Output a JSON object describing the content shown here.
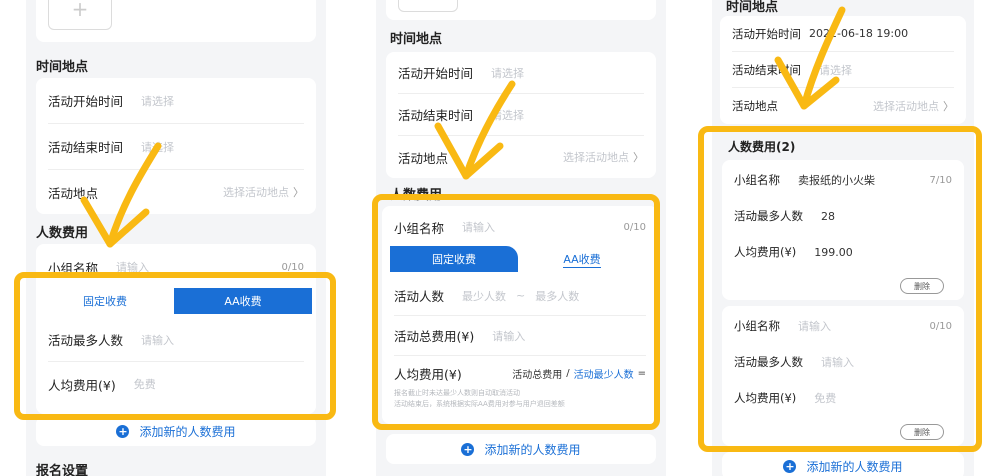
{
  "colors": {
    "accent": "#1a6fd6",
    "highlight": "#f9b913",
    "placeholder": "#c3c6cc"
  },
  "p1": {
    "section_time": "时间地点",
    "start_label": "活动开始时间",
    "start_ph": "请选择",
    "end_label": "活动结束时间",
    "end_ph": "请选择",
    "place_label": "活动地点",
    "place_ph": "选择活动地点",
    "section_fee": "人数费用",
    "group_label": "小组名称",
    "group_ph": "请输入",
    "group_count": "0/10",
    "tab_fixed": "固定收费",
    "tab_aa": "AA收费",
    "max_label": "活动最多人数",
    "max_ph": "请输入",
    "fee_label": "人均费用(¥)",
    "fee_ph": "免费",
    "add_label": "添加新的人数费用",
    "section_reg": "报名设置"
  },
  "p2": {
    "section_time": "时间地点",
    "start_label": "活动开始时间",
    "start_ph": "请选择",
    "end_label": "活动结束时间",
    "end_ph": "请选择",
    "place_label": "活动地点",
    "place_ph": "选择活动地点",
    "section_fee": "人数费用",
    "group_label": "小组名称",
    "group_ph": "请输入",
    "group_count": "0/10",
    "tab_fixed": "固定收费",
    "tab_aa": "AA收费",
    "people_label": "活动人数",
    "min_ph": "最少人数",
    "tilde": "~",
    "max_ph": "最多人数",
    "total_label": "活动总费用(¥)",
    "total_ph": "请输入",
    "avg_label": "人均费用(¥)",
    "formula_total": "活动总费用",
    "formula_slash": "/",
    "formula_min": "活动最少人数",
    "formula_eq": "=",
    "note1": "报名截止时未达最少人数则自动取消活动",
    "note2": "活动结束后，系统根据实际AA费用对参与用户退回差额",
    "add_label": "添加新的人数费用"
  },
  "p3": {
    "section_time": "时间地点",
    "start_label": "活动开始时间",
    "start_val": "2022-06-18 19:00",
    "end_label": "活动结束时间",
    "end_ph": "请选择",
    "place_label": "活动地点",
    "place_ph": "选择活动地点",
    "section_fee": "人数费用(2)",
    "g1_label": "小组名称",
    "g1_val": "卖报纸的小火柴",
    "g1_count": "7/10",
    "max1_label": "活动最多人数",
    "max1_val": "28",
    "fee1_label": "人均费用(¥)",
    "fee1_val": "199.00",
    "delete1": "删除",
    "g2_label": "小组名称",
    "g2_ph": "请输入",
    "g2_count": "0/10",
    "max2_label": "活动最多人数",
    "max2_ph": "请输入",
    "fee2_label": "人均费用(¥)",
    "fee2_ph": "免费",
    "delete2": "删除",
    "add_label": "添加新的人数费用"
  }
}
